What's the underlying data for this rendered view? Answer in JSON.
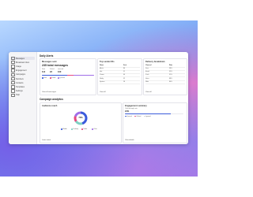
{
  "app": {
    "page_title": "Daily Alerts",
    "section2_title": "Campaign analytics"
  },
  "sidebar": {
    "items": [
      {
        "label": "Messages",
        "icon": "mail-icon"
      },
      {
        "label": "Broadcast inbox",
        "icon": "inbox-icon"
      },
      {
        "label": "Usage",
        "icon": "chart-icon"
      },
      {
        "label": "Engagement",
        "icon": "people-icon"
      },
      {
        "label": "Campaigns",
        "icon": "megaphone-icon"
      },
      {
        "label": "Numbers",
        "icon": "phone-icon"
      },
      {
        "label": "Contacts",
        "icon": "contacts-icon"
      },
      {
        "label": "Templates",
        "icon": "template-icon"
      },
      {
        "label": "Settings",
        "icon": "gear-icon"
      },
      {
        "label": "Help",
        "icon": "help-icon"
      }
    ]
  },
  "cards": {
    "messages": {
      "title": "Messages sent",
      "big": "235 total messages",
      "stats": [
        {
          "label": "Sent",
          "value": "112"
        },
        {
          "label": "Failed",
          "value": "23"
        },
        {
          "label": "Queued",
          "value": "100"
        }
      ],
      "segments": [
        {
          "color": "#3b5bdb",
          "fraction": 0.48
        },
        {
          "color": "#e64980",
          "fraction": 0.12
        },
        {
          "color": "#a06ee8",
          "fraction": 0.4
        }
      ],
      "legend": [
        {
          "label": "Sent",
          "color": "#3b5bdb"
        },
        {
          "label": "Failed",
          "color": "#e64980"
        },
        {
          "label": "Queued",
          "color": "#a06ee8"
        }
      ],
      "link": "View all messages"
    },
    "top_senders": {
      "title": "Top sender IDs",
      "headers": [
        "Name",
        "Sent"
      ],
      "rows": [
        [
          "Alerts",
          "84"
        ],
        [
          "Info",
          "51"
        ],
        [
          "Promo",
          "40"
        ],
        [
          "Notify",
          "32"
        ],
        [
          "System",
          "28"
        ]
      ],
      "link": "View all"
    },
    "delivery": {
      "title": "Delivery breakdown",
      "headers": [
        "Channel",
        "Rate"
      ],
      "rows": [
        [
          "Sms",
          "98%"
        ],
        [
          "Email",
          "95%"
        ],
        [
          "Push",
          "91%"
        ],
        [
          "Voice",
          "88%"
        ],
        [
          "Web",
          "86%"
        ]
      ],
      "link": "View all"
    },
    "donut": {
      "title": "Audience reach",
      "center": "73%",
      "slices": [
        {
          "color": "#3b5bdb",
          "fraction": 0.45
        },
        {
          "color": "#7fd1c4",
          "fraction": 0.2
        },
        {
          "color": "#e64980",
          "fraction": 0.15
        },
        {
          "color": "#a06ee8",
          "fraction": 0.2
        }
      ],
      "legend": [
        {
          "label": "Mobile",
          "color": "#3b5bdb"
        },
        {
          "label": "Desktop",
          "color": "#7fd1c4"
        },
        {
          "label": "Tablet",
          "color": "#e64980"
        },
        {
          "label": "Other",
          "color": "#a06ee8"
        }
      ],
      "link": "Learn more"
    },
    "engagement": {
      "title": "Engagement summary",
      "subtitle": "Click-through rate",
      "value": "24%",
      "progress": 0.78,
      "legend": [
        {
          "label": "Opened",
          "color": "#3b5bdb"
        },
        {
          "label": "Clicked",
          "color": "#e64980"
        },
        {
          "label": "Ignored",
          "color": "#cfcfd8"
        }
      ],
      "link": "View details"
    }
  }
}
